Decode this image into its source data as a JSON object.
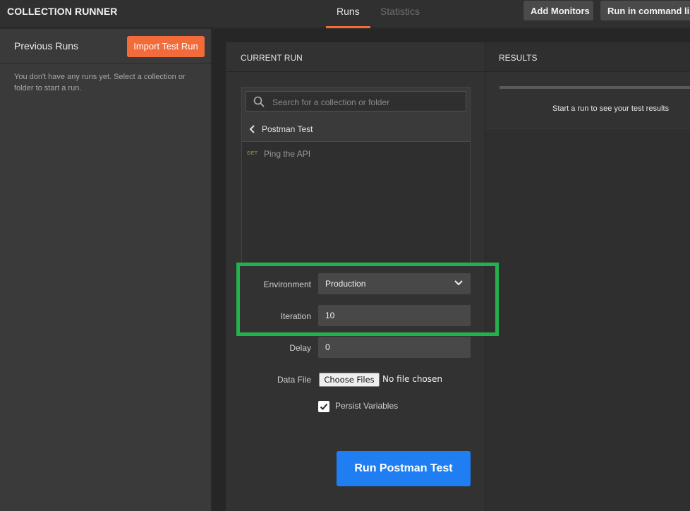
{
  "topbar": {
    "app_title": "COLLECTION RUNNER",
    "tabs": [
      {
        "label": "Runs",
        "active": true
      },
      {
        "label": "Statistics",
        "active": false
      }
    ],
    "add_monitors_label": "Add Monitors",
    "run_cli_label": "Run in command line"
  },
  "sidebar": {
    "title": "Previous Runs",
    "import_label": "Import Test Run",
    "empty_text": "You don't have any runs yet. Select a collection or folder to start a run."
  },
  "current_run": {
    "title": "CURRENT RUN",
    "search_placeholder": "Search for a collection or folder",
    "collection_name": "Postman Test",
    "requests": [
      {
        "method": "GET",
        "name": "Ping the API"
      }
    ],
    "environment": {
      "label": "Environment",
      "value": "Production"
    },
    "iteration": {
      "label": "Iteration",
      "value": "10"
    },
    "delay": {
      "label": "Delay",
      "value": "0"
    },
    "data_file": {
      "label": "Data File",
      "button_label": "Choose Files",
      "status": "No file chosen"
    },
    "persist": {
      "label": "Persist Variables",
      "checked": true
    },
    "run_button_label": "Run Postman Test"
  },
  "results": {
    "title": "RESULTS",
    "empty_message": "Start a run to see your test results"
  },
  "colors": {
    "accent_orange": "#f26b3a",
    "run_blue": "#1f7ff2",
    "highlight_green": "#23b14d",
    "get_method_green": "#6b8f3a"
  }
}
